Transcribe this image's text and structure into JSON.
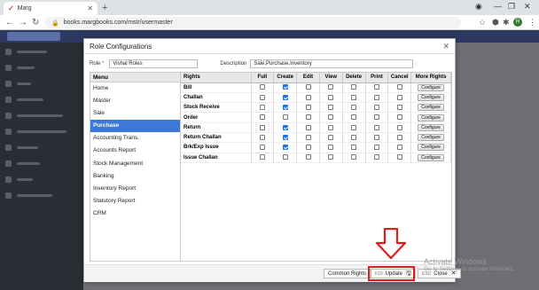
{
  "browser": {
    "tab_title": "Marg",
    "url": "books.margbooks.com/mstr/usermaster"
  },
  "modal": {
    "title": "Role Configurations",
    "role_label": "Role",
    "role_required": "*",
    "role_value": "Vishal Roles",
    "description_label": "Description",
    "description_value": "Sale,Purchase,Inventory"
  },
  "menu": {
    "header": "Menu",
    "items": [
      "Home",
      "Master",
      "Sale",
      "Purchase",
      "Accounting Trans.",
      "Accounts Report",
      "Stock Management",
      "Banking",
      "Inventory Report",
      "Statutory Report",
      "CRM"
    ],
    "active_index": 3
  },
  "grid": {
    "headers": [
      "Rights",
      "Full",
      "Create",
      "Edit",
      "View",
      "Delete",
      "Print",
      "Cancel",
      "More Rights"
    ],
    "configure_label": "Configure",
    "rows": [
      {
        "name": "Bill",
        "checks": [
          false,
          true,
          false,
          false,
          false,
          false,
          false
        ]
      },
      {
        "name": "Challan",
        "checks": [
          false,
          true,
          false,
          false,
          false,
          false,
          false
        ]
      },
      {
        "name": "Stock Receive",
        "checks": [
          false,
          true,
          false,
          false,
          false,
          false,
          false
        ]
      },
      {
        "name": "Order",
        "checks": [
          false,
          false,
          false,
          false,
          false,
          false,
          false
        ]
      },
      {
        "name": "Return",
        "checks": [
          false,
          true,
          false,
          false,
          false,
          false,
          false
        ]
      },
      {
        "name": "Return Challan",
        "checks": [
          false,
          true,
          false,
          false,
          false,
          false,
          false
        ]
      },
      {
        "name": "Brk/Exp Issue",
        "checks": [
          false,
          true,
          false,
          false,
          false,
          false,
          false
        ]
      },
      {
        "name": "Issue Challan",
        "checks": [
          false,
          false,
          false,
          false,
          false,
          false,
          false
        ]
      }
    ]
  },
  "footer": {
    "common_rights": "Common Rights",
    "update_key": "F10",
    "update_label": "Update",
    "close_key": "ESC",
    "close_label": "Close"
  },
  "watermark": {
    "line1": "Activate Windows",
    "line2": "Go to Settings to activate Windows."
  },
  "colors": {
    "accent": "#3c78d8",
    "highlight": "#e21b1b"
  }
}
